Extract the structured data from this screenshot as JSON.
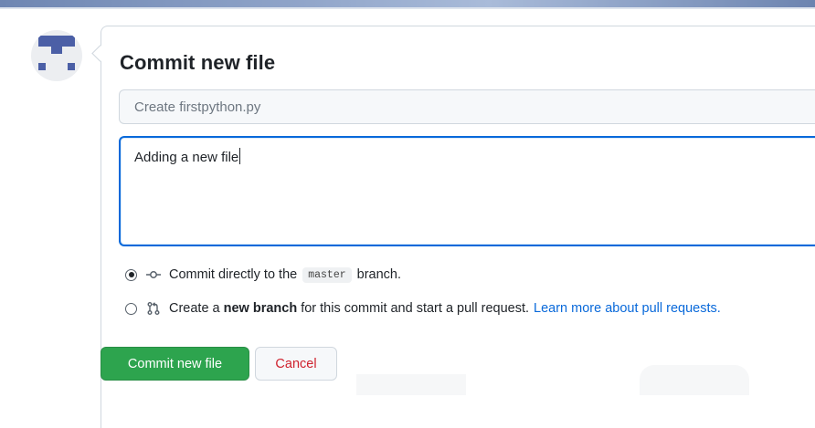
{
  "form": {
    "title": "Commit new file",
    "summary_placeholder": "Create firstpython.py",
    "description_value": "Adding a new file"
  },
  "options": {
    "direct": {
      "prefix": "Commit directly to the",
      "branch": "master",
      "suffix": "branch.",
      "selected": true
    },
    "new_branch": {
      "prefix": "Create a",
      "bold": "new branch",
      "suffix": "for this commit and start a pull request.",
      "link": "Learn more about pull requests.",
      "selected": false
    }
  },
  "buttons": {
    "commit": "Commit new file",
    "cancel": "Cancel"
  },
  "colors": {
    "primary_green": "#2da44e",
    "focus_blue": "#0969da",
    "danger_red": "#cf222e",
    "link_blue": "#0969da"
  },
  "icons": {
    "avatar": "identicon",
    "commit": "git-commit-icon",
    "pull_request": "git-pull-request-icon"
  }
}
